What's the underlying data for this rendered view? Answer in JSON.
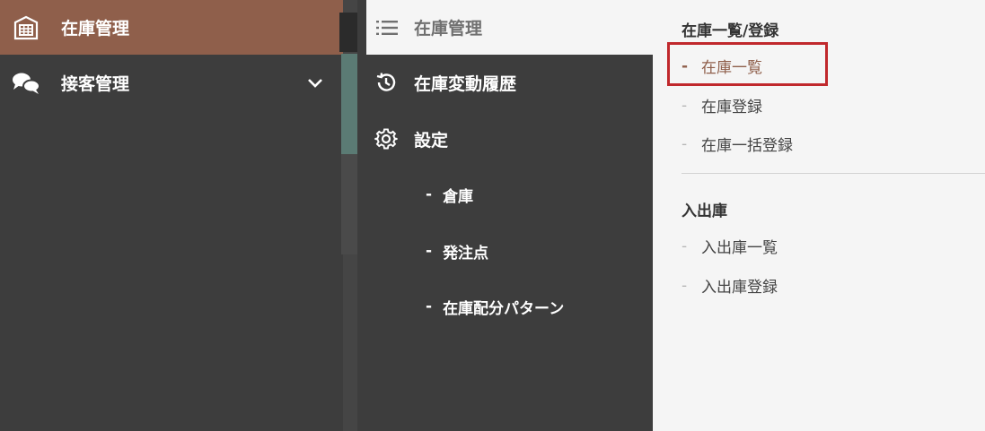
{
  "sidebar": {
    "items": [
      {
        "label": "在庫管理",
        "icon": "inventory-grid-icon",
        "active": true
      },
      {
        "label": "接客管理",
        "icon": "chat-bubbles-icon",
        "expandable": true
      }
    ]
  },
  "middle": {
    "header": {
      "label": "在庫管理",
      "icon": "list-icon"
    },
    "items": [
      {
        "label": "在庫変動履歴",
        "icon": "history-icon"
      },
      {
        "label": "設定",
        "icon": "gear-icon"
      }
    ],
    "settings_sub": [
      "倉庫",
      "発注点",
      "在庫配分パターン"
    ],
    "dash": "-"
  },
  "right": {
    "sections": [
      {
        "title": "在庫一覧/登録",
        "links": [
          "在庫一覧",
          "在庫登録",
          "在庫一括登録"
        ]
      },
      {
        "title": "入出庫",
        "links": [
          "入出庫一覧",
          "入出庫登録"
        ]
      }
    ],
    "dash": "-",
    "current": "在庫一覧"
  },
  "colors": {
    "accent": "#8f5f4b",
    "sidebar_bg": "#3d3d3d",
    "panel_bg": "#f5f5f5",
    "highlight": "#c0282c"
  }
}
